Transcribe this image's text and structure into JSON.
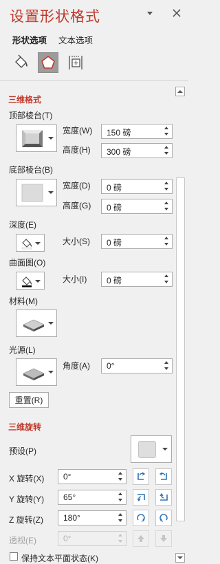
{
  "header": {
    "title": "设置形状格式",
    "tabs": [
      "形状选项",
      "文本选项"
    ]
  },
  "colors": {
    "accent": "#c0392b",
    "selected_icon_bg": "#9c9c9c"
  },
  "icons": [
    "fill-line-icon",
    "effects-pentagon-icon",
    "size-properties-icon",
    "collapse-icon",
    "close-icon"
  ],
  "format3d": {
    "title": "三维格式",
    "top_bevel": {
      "label": "顶部棱台(T)",
      "width_label": "宽度(W)",
      "width_value": "150 磅",
      "height_label": "高度(H)",
      "height_value": "300 磅"
    },
    "bottom_bevel": {
      "label": "底部棱台(B)",
      "width_label": "宽度(D)",
      "width_value": "0 磅",
      "height_label": "高度(G)",
      "height_value": "0 磅"
    },
    "depth": {
      "label": "深度(E)",
      "size_label": "大小(S)",
      "size_value": "0 磅"
    },
    "contour": {
      "label": "曲面图(O)",
      "size_label": "大小(I)",
      "size_value": "0 磅"
    },
    "material": {
      "label": "材料(M)"
    },
    "lighting": {
      "label": "光源(L)",
      "angle_label": "角度(A)",
      "angle_value": "0°"
    },
    "reset_label": "重置(R)"
  },
  "rotation3d": {
    "title": "三维旋转",
    "preset_label": "预设(P)",
    "x": {
      "label": "X 旋转(X)",
      "value": "0°"
    },
    "y": {
      "label": "Y 旋转(Y)",
      "value": "65°"
    },
    "z": {
      "label": "Z 旋转(Z)",
      "value": "180°"
    },
    "perspective": {
      "label": "透视(E)",
      "value": "0°"
    },
    "keep_text_flat_label": "保持文本平面状态(K)",
    "keep_text_flat_checked": false
  }
}
